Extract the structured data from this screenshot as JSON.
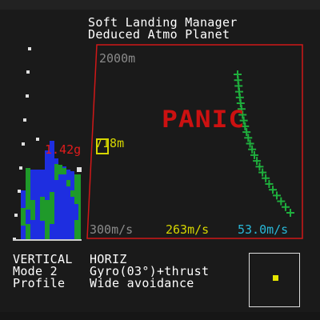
{
  "header": {
    "title": "Soft Landing Manager",
    "subtitle": "Deduced Atmo Planet"
  },
  "plot": {
    "altitude_scale_label": "2000m",
    "speed_scale_label": "300m/s",
    "current_speed_label": "263m/s",
    "horizontal_speed_label": "53.0m/s",
    "alert_text": "PANIC",
    "g_force_label": "1.42g",
    "current_altitude_label": "718m",
    "trajectory_count": 25
  },
  "status": {
    "labels": {
      "vertical": "VERTICAL",
      "horiz": "HORIZ",
      "mode": "Mode 2",
      "profile": "Profile"
    },
    "values": {
      "mode_detail": "Gyro(03°)+thrust",
      "profile_detail": "Wide avoidance"
    }
  },
  "colors": {
    "frame": "#d01818",
    "alert": "#cc1111",
    "trajectory": "#1fae3d",
    "speed_yellow": "#d6d600",
    "speed_cyan": "#29b8d8",
    "bar_blue": "#1e2ee0",
    "bar_green": "#1f9a2a"
  }
}
